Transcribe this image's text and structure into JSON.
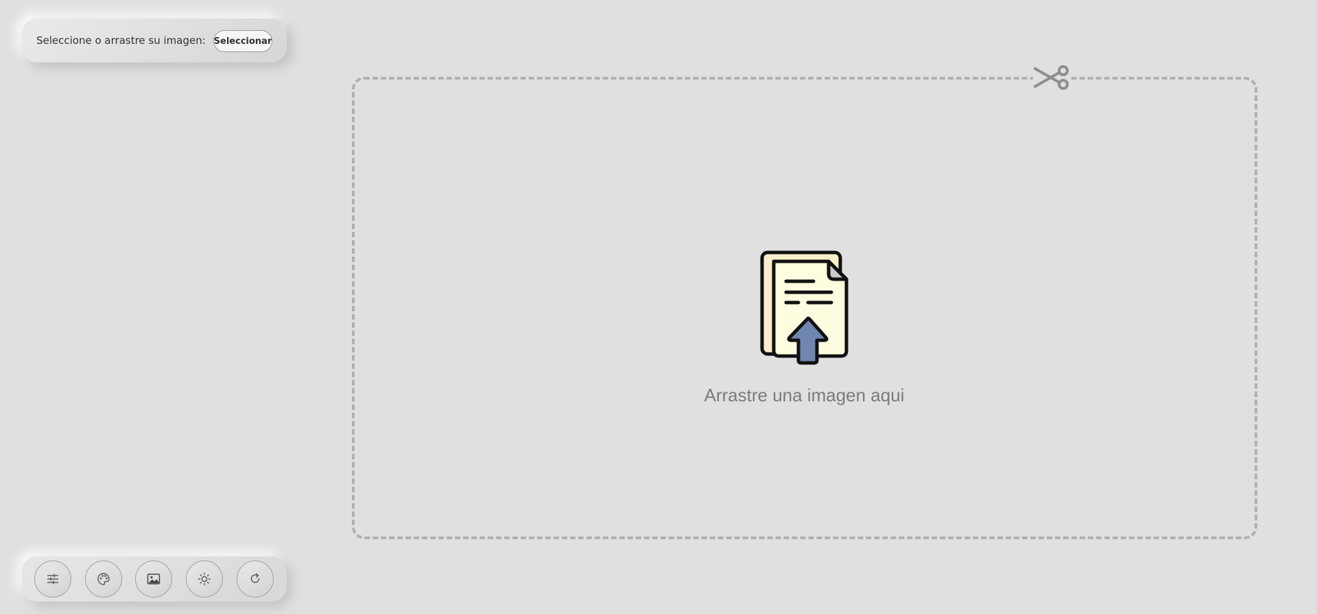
{
  "upload_panel": {
    "label": "Seleccione o arrastre su imagen:",
    "button_label": "Seleccionar"
  },
  "drop_zone": {
    "text": "Arrastre una imagen aqui",
    "icon": "file-upload-icon",
    "corner_icon": "scissors-icon"
  },
  "toolbar": {
    "buttons": [
      {
        "icon": "sliders-icon"
      },
      {
        "icon": "palette-icon"
      },
      {
        "icon": "image-icon"
      },
      {
        "icon": "brightness-icon"
      },
      {
        "icon": "rotate-icon"
      }
    ]
  },
  "colors": {
    "background": "#e0e0e0",
    "dashed_border": "#b0b0b0",
    "drop_text": "#7b7b7b",
    "document_fill": "#fffde0",
    "arrow_fill": "#6f86b0"
  }
}
